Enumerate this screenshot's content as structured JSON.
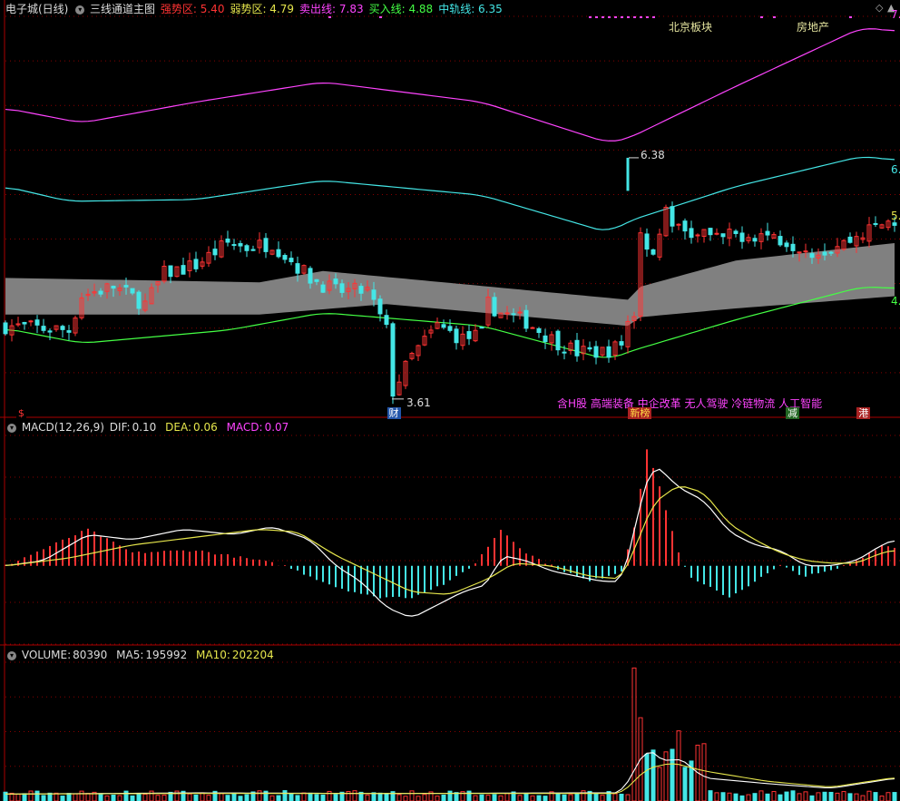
{
  "main_header": {
    "stock": "电子城(日线)",
    "indicator": "三线通道主图",
    "items": [
      {
        "label": "强势区:",
        "value": "5.40",
        "color": "#ff3333"
      },
      {
        "label": "弱势区:",
        "value": "4.79",
        "color": "#e6e64c"
      },
      {
        "label": "卖出线:",
        "value": "7.83",
        "color": "#ff44ff"
      },
      {
        "label": "买入线:",
        "value": "4.88",
        "color": "#44ff44"
      },
      {
        "label": "中轨线:",
        "value": "6.35",
        "color": "#44e6e6"
      }
    ]
  },
  "right_labels": [
    {
      "text": "7.",
      "y": 0.032,
      "color": "#ff44ff"
    },
    {
      "text": "6.",
      "y": 0.405,
      "color": "#44e6e6"
    },
    {
      "text": "5.",
      "y": 0.515,
      "color": "#e6e64c"
    },
    {
      "text": "4.",
      "y": 0.72,
      "color": "#44ff44"
    }
  ],
  "annotations": {
    "high_marker": "6.38",
    "low_marker": "3.61",
    "concepts": "含H股 高端装备 中企改革 无人驾驶 冷链物流 人工智能",
    "sector_left": "北京板块",
    "sector_right": "房地产",
    "event_tags": [
      {
        "text": "$",
        "bg": "#000",
        "color": "#ff3333",
        "x": 0.018
      },
      {
        "text": "财",
        "bg": "#2255aa",
        "color": "#fff",
        "x": 0.43
      },
      {
        "text": "新榜",
        "bg": "#aa2222",
        "color": "#ffdd44",
        "x": 0.698
      },
      {
        "text": "减",
        "bg": "#226622",
        "color": "#fff",
        "x": 0.873
      },
      {
        "text": "港",
        "bg": "#aa2222",
        "color": "#fff",
        "x": 0.952
      }
    ]
  },
  "macd_header": {
    "name": "MACD(12,26,9)",
    "dif_label": "DIF:",
    "dif_value": "0.10",
    "dea_label": "DEA:",
    "dea_value": "0.06",
    "macd_label": "MACD:",
    "macd_value": "0.07"
  },
  "volume_header": {
    "name": "VOLUME:",
    "value": "80390",
    "ma5_label": "MA5:",
    "ma5_value": "195992",
    "ma10_label": "MA10:",
    "ma10_value": "202204"
  },
  "colors": {
    "up": "#ff3333",
    "down": "#44e6e6",
    "band": "#808080",
    "sell_line": "#ff44ff",
    "mid_line": "#44e6e6",
    "buy_line": "#44ff44",
    "grid": "#880000",
    "dif": "#ffffff",
    "dea": "#e6e64c"
  },
  "chart_data": [
    {
      "type": "candlestick",
      "title": "三线通道主图",
      "price_range": [
        3.4,
        7.9
      ],
      "notes": "Estimated prices; candles approximated, 140 sessions",
      "series": [
        {
          "name": "卖出线",
          "control_points": [
            [
              0,
              6.95
            ],
            [
              12,
              6.78
            ],
            [
              30,
              7.02
            ],
            [
              50,
              7.25
            ],
            [
              75,
              7.02
            ],
            [
              95,
              6.55
            ],
            [
              98,
              6.6
            ],
            [
              115,
              7.2
            ],
            [
              135,
              7.88
            ],
            [
              140,
              7.83
            ]
          ]
        },
        {
          "name": "中轨线",
          "control_points": [
            [
              0,
              6.05
            ],
            [
              10,
              5.88
            ],
            [
              30,
              5.9
            ],
            [
              50,
              6.12
            ],
            [
              75,
              5.95
            ],
            [
              95,
              5.52
            ],
            [
              98,
              5.65
            ],
            [
              115,
              6.05
            ],
            [
              135,
              6.4
            ],
            [
              140,
              6.35
            ]
          ]
        },
        {
          "name": "买入线",
          "control_points": [
            [
              0,
              4.42
            ],
            [
              12,
              4.25
            ],
            [
              35,
              4.4
            ],
            [
              50,
              4.6
            ],
            [
              75,
              4.45
            ],
            [
              95,
              4.06
            ],
            [
              98,
              4.15
            ],
            [
              115,
              4.52
            ],
            [
              135,
              4.9
            ],
            [
              140,
              4.88
            ]
          ]
        },
        {
          "name": "强势区",
          "control_points": [
            [
              0,
              5.0
            ],
            [
              40,
              4.95
            ],
            [
              50,
              5.08
            ],
            [
              98,
              4.75
            ],
            [
              100,
              4.9
            ],
            [
              115,
              5.2
            ],
            [
              140,
              5.4
            ]
          ]
        },
        {
          "name": "弱势区",
          "control_points": [
            [
              0,
              4.58
            ],
            [
              40,
              4.58
            ],
            [
              60,
              4.7
            ],
            [
              98,
              4.45
            ],
            [
              100,
              4.55
            ],
            [
              115,
              4.65
            ],
            [
              140,
              4.79
            ]
          ]
        }
      ],
      "close_path": [
        [
          0,
          4.45
        ],
        [
          10,
          4.4
        ],
        [
          12,
          4.8
        ],
        [
          17,
          4.9
        ],
        [
          22,
          4.7
        ],
        [
          25,
          5.05
        ],
        [
          30,
          5.15
        ],
        [
          35,
          5.4
        ],
        [
          38,
          5.35
        ],
        [
          42,
          5.4
        ],
        [
          48,
          5.0
        ],
        [
          52,
          4.85
        ],
        [
          57,
          4.85
        ],
        [
          60,
          4.4
        ],
        [
          61,
          3.7
        ],
        [
          64,
          4.1
        ],
        [
          68,
          4.45
        ],
        [
          72,
          4.3
        ],
        [
          75,
          4.35
        ],
        [
          76,
          4.7
        ],
        [
          78,
          4.6
        ],
        [
          82,
          4.5
        ],
        [
          86,
          4.3
        ],
        [
          90,
          4.15
        ],
        [
          94,
          4.15
        ],
        [
          96,
          4.2
        ],
        [
          97,
          4.25
        ],
        [
          98,
          4.5
        ],
        [
          99,
          4.6
        ],
        [
          100,
          5.5
        ],
        [
          102,
          5.3
        ],
        [
          104,
          5.75
        ],
        [
          106,
          5.55
        ],
        [
          108,
          5.5
        ],
        [
          112,
          5.45
        ],
        [
          116,
          5.5
        ],
        [
          120,
          5.5
        ],
        [
          124,
          5.4
        ],
        [
          128,
          5.3
        ],
        [
          132,
          5.4
        ],
        [
          136,
          5.55
        ],
        [
          139,
          5.65
        ]
      ],
      "high_marker": 6.38,
      "low_marker": 3.61
    },
    {
      "type": "line+bar",
      "title": "MACD(12,26,9)",
      "value_range": [
        -0.3,
        0.5
      ],
      "series": [
        {
          "name": "DIF",
          "control_points": [
            [
              0,
              0.0
            ],
            [
              6,
              0.02
            ],
            [
              13,
              0.12
            ],
            [
              20,
              0.1
            ],
            [
              28,
              0.14
            ],
            [
              36,
              0.12
            ],
            [
              42,
              0.15
            ],
            [
              48,
              0.1
            ],
            [
              52,
              0.0
            ],
            [
              56,
              -0.06
            ],
            [
              60,
              -0.16
            ],
            [
              64,
              -0.2
            ],
            [
              68,
              -0.15
            ],
            [
              72,
              -0.1
            ],
            [
              76,
              -0.07
            ],
            [
              78,
              0.04
            ],
            [
              82,
              0.02
            ],
            [
              86,
              -0.02
            ],
            [
              90,
              -0.04
            ],
            [
              94,
              -0.06
            ],
            [
              97,
              -0.06
            ],
            [
              98,
              0.02
            ],
            [
              100,
              0.25
            ],
            [
              102,
              0.39
            ],
            [
              104,
              0.35
            ],
            [
              106,
              0.3
            ],
            [
              110,
              0.25
            ],
            [
              114,
              0.13
            ],
            [
              118,
              0.08
            ],
            [
              122,
              0.06
            ],
            [
              126,
              0.0
            ],
            [
              130,
              0.0
            ],
            [
              134,
              0.02
            ],
            [
              138,
              0.08
            ],
            [
              140,
              0.1
            ]
          ]
        },
        {
          "name": "DEA",
          "control_points": [
            [
              0,
              0.0
            ],
            [
              10,
              0.03
            ],
            [
              20,
              0.08
            ],
            [
              30,
              0.11
            ],
            [
              40,
              0.14
            ],
            [
              46,
              0.13
            ],
            [
              52,
              0.04
            ],
            [
              58,
              -0.03
            ],
            [
              64,
              -0.1
            ],
            [
              70,
              -0.11
            ],
            [
              76,
              -0.05
            ],
            [
              80,
              0.01
            ],
            [
              86,
              0.0
            ],
            [
              92,
              -0.04
            ],
            [
              97,
              -0.05
            ],
            [
              100,
              0.12
            ],
            [
              102,
              0.24
            ],
            [
              106,
              0.31
            ],
            [
              110,
              0.28
            ],
            [
              114,
              0.16
            ],
            [
              118,
              0.1
            ],
            [
              122,
              0.05
            ],
            [
              126,
              0.02
            ],
            [
              130,
              0.01
            ],
            [
              134,
              0.01
            ],
            [
              138,
              0.05
            ],
            [
              140,
              0.06
            ]
          ]
        },
        {
          "name": "MACD",
          "control_points": [
            [
              0,
              0.0
            ],
            [
              13,
              0.14
            ],
            [
              20,
              0.05
            ],
            [
              30,
              0.06
            ],
            [
              40,
              0.02
            ],
            [
              44,
              0.0
            ],
            [
              52,
              -0.08
            ],
            [
              58,
              -0.12
            ],
            [
              64,
              -0.12
            ],
            [
              70,
              -0.06
            ],
            [
              74,
              0.01
            ],
            [
              78,
              0.14
            ],
            [
              82,
              0.05
            ],
            [
              86,
              0.0
            ],
            [
              92,
              -0.06
            ],
            [
              97,
              -0.02
            ],
            [
              99,
              0.15
            ],
            [
              101,
              0.45
            ],
            [
              103,
              0.3
            ],
            [
              106,
              0.05
            ],
            [
              108,
              -0.05
            ],
            [
              114,
              -0.12
            ],
            [
              118,
              -0.06
            ],
            [
              122,
              0.0
            ],
            [
              126,
              -0.04
            ],
            [
              130,
              -0.02
            ],
            [
              134,
              0.02
            ],
            [
              138,
              0.08
            ],
            [
              140,
              0.07
            ]
          ]
        }
      ]
    },
    {
      "type": "bar+line",
      "title": "VOLUME",
      "value_range": [
        0,
        1200000
      ],
      "series": [
        {
          "name": "MA5",
          "control_points": [
            [
              0,
              60000
            ],
            [
              30,
              70000
            ],
            [
              60,
              65000
            ],
            [
              90,
              70000
            ],
            [
              97,
              70000
            ],
            [
              101,
              460000
            ],
            [
              104,
              330000
            ],
            [
              106,
              380000
            ],
            [
              110,
              200000
            ],
            [
              120,
              150000
            ],
            [
              130,
              110000
            ],
            [
              140,
              196000
            ]
          ]
        },
        {
          "name": "MA10",
          "control_points": [
            [
              0,
              60000
            ],
            [
              30,
              65000
            ],
            [
              60,
              65000
            ],
            [
              90,
              65000
            ],
            [
              97,
              65000
            ],
            [
              101,
              280000
            ],
            [
              105,
              330000
            ],
            [
              110,
              260000
            ],
            [
              120,
              170000
            ],
            [
              130,
              120000
            ],
            [
              140,
              202000
            ]
          ]
        }
      ]
    }
  ]
}
